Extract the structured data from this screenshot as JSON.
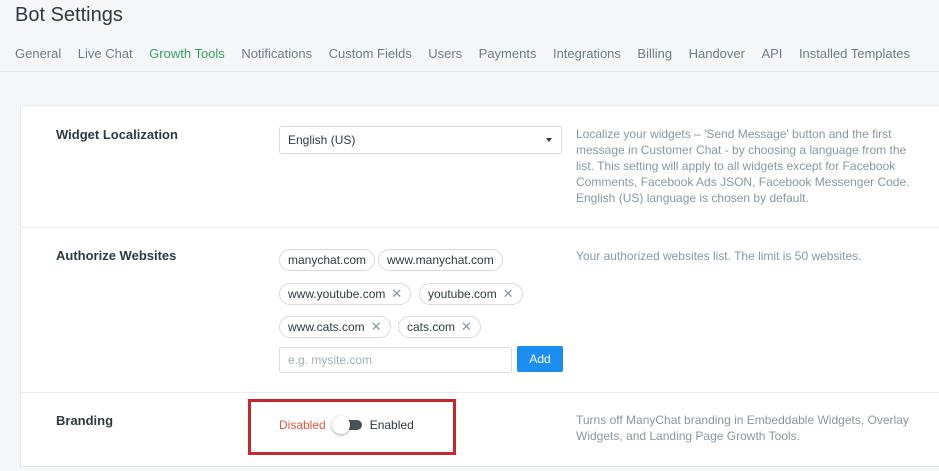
{
  "header": {
    "title": "Bot Settings"
  },
  "tabs": [
    {
      "label": "General"
    },
    {
      "label": "Live Chat"
    },
    {
      "label": "Growth Tools",
      "active": true
    },
    {
      "label": "Notifications"
    },
    {
      "label": "Custom Fields"
    },
    {
      "label": "Users"
    },
    {
      "label": "Payments"
    },
    {
      "label": "Integrations"
    },
    {
      "label": "Billing"
    },
    {
      "label": "Handover"
    },
    {
      "label": "API"
    },
    {
      "label": "Installed Templates"
    }
  ],
  "widget_localization": {
    "label": "Widget Localization",
    "selected_language": "English (US)",
    "description": "Localize your widgets – 'Send Message' button and the first message in Customer Chat - by choosing a language from the list. This setting will apply to all widgets except for Facebook Comments, Facebook Ads JSON, Facebook Messenger Code. English (US) language is chosen by default."
  },
  "authorize_websites": {
    "label": "Authorize Websites",
    "sites": [
      {
        "name": "manychat.com",
        "removable": false
      },
      {
        "name": "www.manychat.com",
        "removable": false
      },
      {
        "name": "www.youtube.com",
        "removable": true
      },
      {
        "name": "youtube.com",
        "removable": true
      },
      {
        "name": "www.cats.com",
        "removable": true
      },
      {
        "name": "cats.com",
        "removable": true
      }
    ],
    "remove_glyph": "✕",
    "input_placeholder": "e.g. mysite.com",
    "add_label": "Add",
    "description": "Your authorized websites list. The limit is 50 websites."
  },
  "branding": {
    "label": "Branding",
    "off_label": "Disabled",
    "on_label": "Enabled",
    "enabled": false,
    "description": "Turns off ManyChat branding in Embeddable Widgets, Overlay Widgets, and Landing Page Growth Tools."
  },
  "colors": {
    "active_tab": "#35a35f",
    "add_button": "#1c8ef2",
    "disabled_text": "#e8563f",
    "highlight_border": "#c4282c"
  }
}
